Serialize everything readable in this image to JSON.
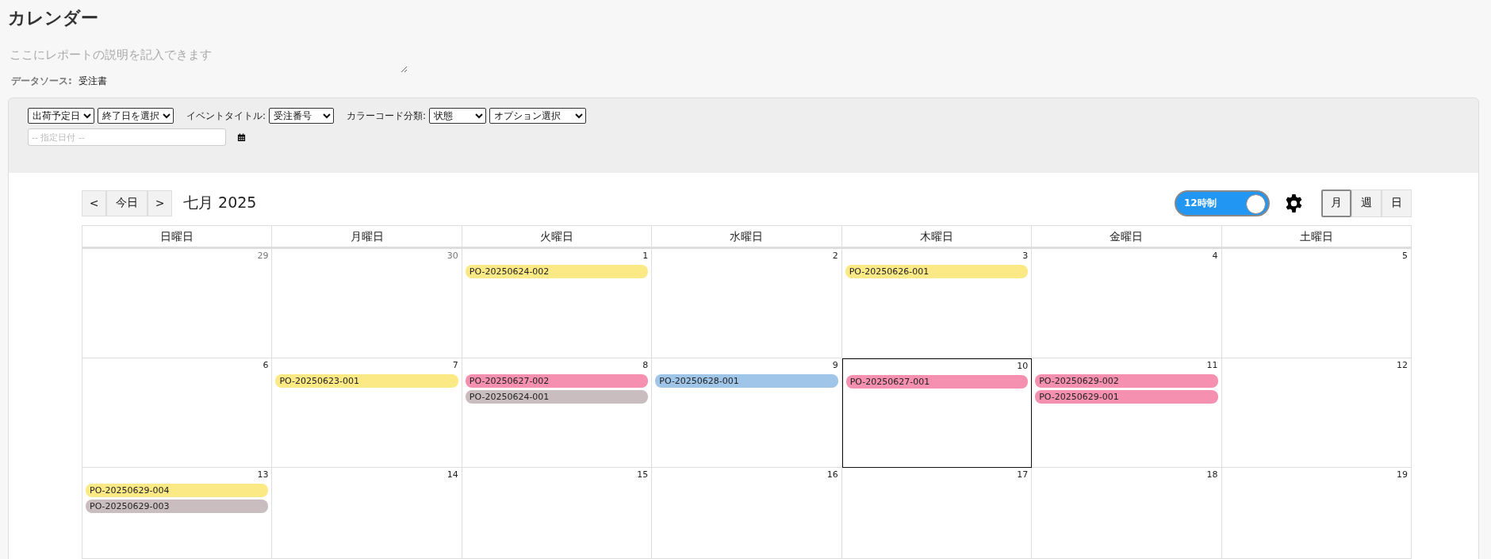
{
  "page": {
    "title": "カレンダー",
    "description_placeholder": "ここにレポートの説明を記入できます",
    "data_source_label": "データソース:",
    "data_source": "受注書"
  },
  "filters": {
    "start_field": "出荷予定日",
    "end_field": "終了日を選択",
    "event_title_label": "イベントタイトル:",
    "event_title": "受注番号",
    "color_code_label": "カラーコード分類:",
    "color_code": "状態",
    "option": "オプション選択",
    "date_placeholder": "-- 指定日付 --"
  },
  "toolbar": {
    "prev": "<",
    "today": "今日",
    "next": ">",
    "month_title": "七月 2025",
    "clock_toggle": {
      "label": "12時制",
      "on": true
    },
    "views": [
      {
        "label": "月",
        "selected": true
      },
      {
        "label": "週",
        "selected": false
      },
      {
        "label": "日",
        "selected": false
      }
    ]
  },
  "weekdays": [
    "日曜日",
    "月曜日",
    "火曜日",
    "水曜日",
    "木曜日",
    "金曜日",
    "土曜日"
  ],
  "weeks": [
    [
      {
        "day": "29",
        "other_month": true,
        "today": false
      },
      {
        "day": "30",
        "other_month": true,
        "today": false
      },
      {
        "day": "1",
        "other_month": false,
        "today": false,
        "events": [
          {
            "title": "PO-20250624-002",
            "color": "#fae985"
          }
        ]
      },
      {
        "day": "2",
        "other_month": false,
        "today": false
      },
      {
        "day": "3",
        "other_month": false,
        "today": false,
        "events": [
          {
            "title": "PO-20250626-001",
            "color": "#fae985"
          }
        ]
      },
      {
        "day": "4",
        "other_month": false,
        "today": false
      },
      {
        "day": "5",
        "other_month": false,
        "today": false
      }
    ],
    [
      {
        "day": "6",
        "other_month": false,
        "today": false
      },
      {
        "day": "7",
        "other_month": false,
        "today": false,
        "events": [
          {
            "title": "PO-20250623-001",
            "color": "#fae985"
          }
        ]
      },
      {
        "day": "8",
        "other_month": false,
        "today": false,
        "events": [
          {
            "title": "PO-20250627-002",
            "color": "#f590b0"
          },
          {
            "title": "PO-20250624-001",
            "color": "#c9bdbf"
          }
        ]
      },
      {
        "day": "9",
        "other_month": false,
        "today": false,
        "events": [
          {
            "title": "PO-20250628-001",
            "color": "#9fc5e8"
          }
        ]
      },
      {
        "day": "10",
        "other_month": false,
        "today": true,
        "events": [
          {
            "title": "PO-20250627-001",
            "color": "#f590b0"
          }
        ]
      },
      {
        "day": "11",
        "other_month": false,
        "today": false,
        "events": [
          {
            "title": "PO-20250629-002",
            "color": "#f590b0"
          },
          {
            "title": "PO-20250629-001",
            "color": "#f590b0"
          }
        ]
      },
      {
        "day": "12",
        "other_month": false,
        "today": false
      }
    ],
    [
      {
        "day": "13",
        "other_month": false,
        "today": false,
        "events": [
          {
            "title": "PO-20250629-004",
            "color": "#fae985"
          },
          {
            "title": "PO-20250629-003",
            "color": "#c9bdbf"
          }
        ]
      },
      {
        "day": "14",
        "other_month": false,
        "today": false
      },
      {
        "day": "15",
        "other_month": false,
        "today": false
      },
      {
        "day": "16",
        "other_month": false,
        "today": false
      },
      {
        "day": "17",
        "other_month": false,
        "today": false
      },
      {
        "day": "18",
        "other_month": false,
        "today": false
      },
      {
        "day": "19",
        "other_month": false,
        "today": false
      }
    ]
  ]
}
